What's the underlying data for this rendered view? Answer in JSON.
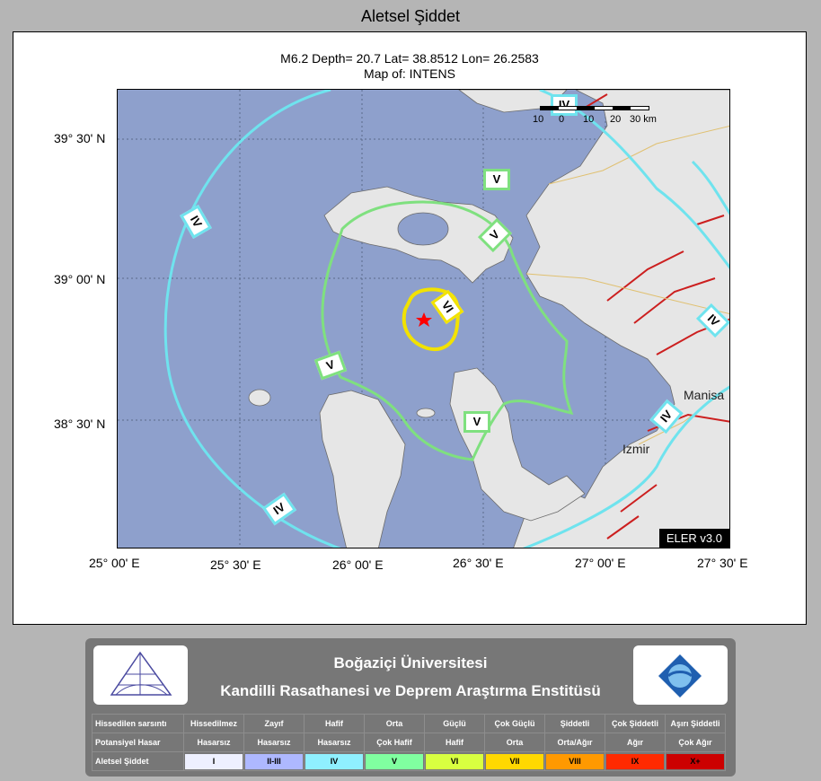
{
  "page_title": "Aletsel Şiddet",
  "map": {
    "caption_line1": "M6.2 Depth= 20.7 Lat= 38.8512 Lon= 26.2583",
    "caption_line2": "Map of: INTENS",
    "lat_labels": [
      "39° 30' N",
      "39° 00' N",
      "38° 30' N"
    ],
    "lon_labels": [
      "25° 00' E",
      "25° 30' E",
      "26° 00' E",
      "26° 30' E",
      "27° 00' E",
      "27° 30' E"
    ],
    "scale_ticks": [
      "10",
      "0",
      "10",
      "20",
      "30 km"
    ],
    "version": "ELER v3.0",
    "cities": [
      "Manisa",
      "Izmir"
    ],
    "contour_labels": {
      "iv": "IV",
      "v": "V",
      "vi": "VI"
    },
    "colors": {
      "sea": "#8ea0cc",
      "land": "#e6e6e6",
      "contour_iv": "#6fe3ee",
      "contour_v": "#7fe07f",
      "contour_vi": "#f2e200",
      "epicenter": "#ff0000",
      "faults": "#cc1f1f"
    }
  },
  "legend": {
    "title_line1": "Boğaziçi Üniversitesi",
    "title_line2": "Kandilli Rasathanesi ve Deprem Araştırma Enstitüsü",
    "row_headers": [
      "Hissedilen sarsıntı",
      "Potansiyel Hasar",
      "Aletsel Şiddet"
    ],
    "shaking": [
      "Hissedilmez",
      "Zayıf",
      "Hafif",
      "Orta",
      "Güçlü",
      "Çok Güçlü",
      "Şiddetli",
      "Çok Şiddetli",
      "Aşırı Şiddetli"
    ],
    "damage": [
      "Hasarsız",
      "Hasarsız",
      "Hasarsız",
      "Çok Hafif",
      "Hafif",
      "Orta",
      "Orta/Ağır",
      "Ağır",
      "Çok Ağır"
    ],
    "intensity": [
      "I",
      "II-III",
      "IV",
      "V",
      "VI",
      "VII",
      "VIII",
      "IX",
      "X+"
    ],
    "intensity_colors": [
      "#eef0ff",
      "#aeb8ff",
      "#8ff0ff",
      "#80ffa0",
      "#d8ff40",
      "#ffd800",
      "#ff9900",
      "#ff2a00",
      "#cc0000"
    ]
  }
}
